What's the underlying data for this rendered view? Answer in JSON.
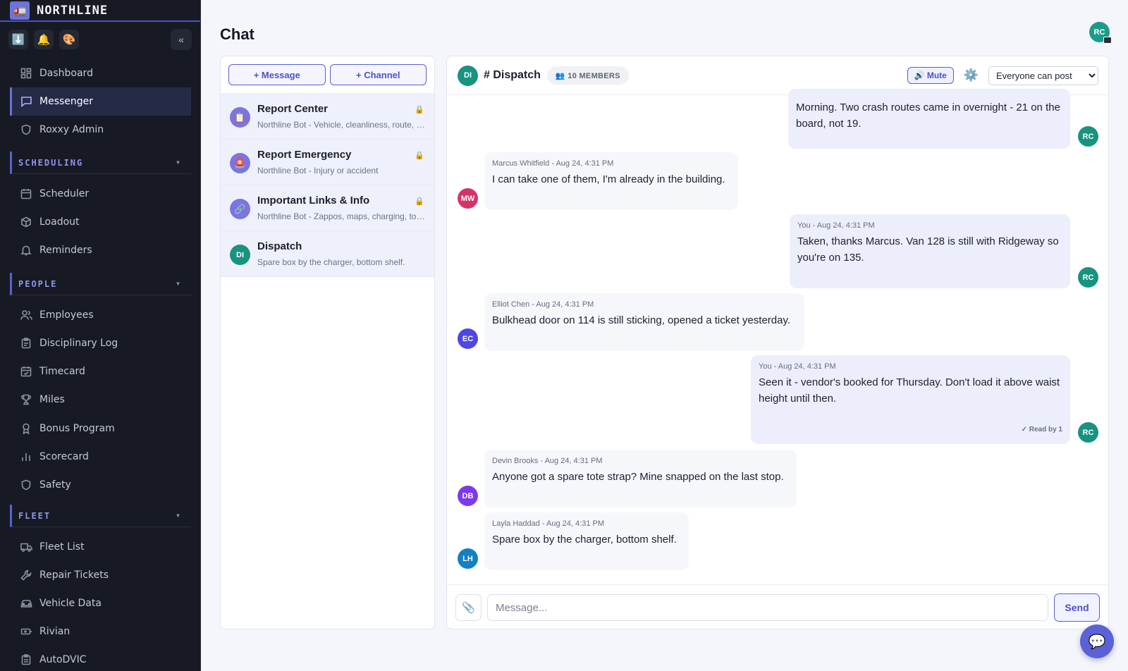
{
  "brand": {
    "name": "NORTHLINE",
    "logo_glyph": "🚛"
  },
  "quick_actions": [
    {
      "name": "download-icon",
      "glyph": "⬇️"
    },
    {
      "name": "bell-icon",
      "glyph": "🔔"
    },
    {
      "name": "palette-icon",
      "glyph": "🎨"
    }
  ],
  "collapse_glyph": "«",
  "sidebar": {
    "top_items": [
      "Dashboard",
      "Messenger",
      "Roxxy Admin"
    ],
    "sections": {
      "scheduling": {
        "title": "SCHEDULING",
        "items": [
          "Scheduler",
          "Loadout",
          "Reminders"
        ]
      },
      "people": {
        "title": "PEOPLE",
        "items": [
          "Employees",
          "Disciplinary Log",
          "Timecard",
          "Miles",
          "Bonus Program",
          "Scorecard",
          "Safety"
        ]
      },
      "fleet": {
        "title": "FLEET",
        "items": [
          "Fleet List",
          "Repair Tickets",
          "Vehicle Data",
          "Rivian",
          "AutoDVIC"
        ]
      }
    },
    "active_item": "Messenger"
  },
  "page": {
    "title": "Chat",
    "user_initials": "RC"
  },
  "channel_list": {
    "new_message_label": "+ Message",
    "new_channel_label": "+ Channel",
    "channels": [
      {
        "name": "Report Center",
        "preview": "Northline Bot - Vehicle, cleanliness, route, equipment",
        "icon": "📋",
        "locked": true
      },
      {
        "name": "Report Emergency",
        "preview": "Northline Bot - Injury or accident",
        "icon": "🚨",
        "locked": true
      },
      {
        "name": "Important Links & Info",
        "preview": "Northline Bot - Zappos, maps, charging, tools",
        "icon": "🔗",
        "locked": true
      },
      {
        "name": "Dispatch",
        "preview": "Spare box by the charger, bottom shelf.",
        "initials": "DI",
        "locked": false
      }
    ],
    "lock_glyph": "🔒"
  },
  "chat": {
    "channel_initials": "DI",
    "channel_title": "# Dispatch",
    "members_badge": "👥 10 MEMBERS",
    "mute_label": "🔊 Mute",
    "settings_glyph": "⚙️",
    "post_permission": {
      "selected": "Everyone can post",
      "options": [
        "Everyone can post"
      ]
    },
    "messages": [
      {
        "author": "You",
        "meta": "",
        "text": "Morning. Two crash routes came in overnight - 21 on the board, not 19.",
        "initials": "RC",
        "color": "#17937f"
      },
      {
        "author": "Marcus Whitfield",
        "meta": "Marcus Whitfield - Aug 24, 4:31 PM",
        "text": "I can take one of them, I'm already in the building.",
        "initials": "MW",
        "color": "#d6336c"
      },
      {
        "author": "You",
        "meta": "You - Aug 24, 4:31 PM",
        "text": "Taken, thanks Marcus. Van 128 is still with Ridgeway so you're on 135.",
        "initials": "RC",
        "color": "#17937f"
      },
      {
        "author": "Elliot Chen",
        "meta": "Elliot Chen - Aug 24, 4:31 PM",
        "text": "Bulkhead door on 114 is still sticking, opened a ticket yesterday.",
        "initials": "EC",
        "color": "#4f46e5"
      },
      {
        "author": "You",
        "meta": "You - Aug 24, 4:31 PM",
        "text": "Seen it - vendor's booked for Thursday. Don't load it above waist height until then.",
        "initials": "RC",
        "color": "#17937f",
        "read_receipt": "✓ Read by 1"
      },
      {
        "author": "Devin Brooks",
        "meta": "Devin Brooks - Aug 24, 4:31 PM",
        "text": "Anyone got a spare tote strap? Mine snapped on the last stop.",
        "initials": "DB",
        "color": "#7c3aed"
      },
      {
        "author": "Layla Haddad",
        "meta": "Layla Haddad - Aug 24, 4:31 PM",
        "text": "Spare box by the charger, bottom shelf.",
        "initials": "LH",
        "color": "#1281c4"
      }
    ],
    "composer": {
      "placeholder": "Message...",
      "send_label": "Send",
      "attach_glyph": "📎"
    }
  },
  "fab_glyph": "💬"
}
